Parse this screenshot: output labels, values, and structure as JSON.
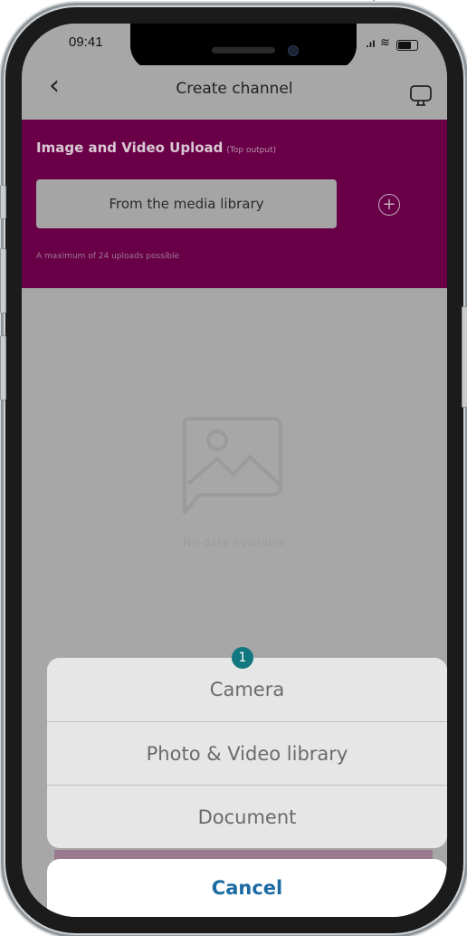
{
  "status_bar": {
    "time": "09:41"
  },
  "nav": {
    "back_icon": "chevron-left-icon",
    "title": "Create channel",
    "device_icon": "monitor-icon"
  },
  "upload": {
    "title": "Image and Video Upload",
    "subtitle": "(Top output)",
    "library_button": "From the media library",
    "add_icon": "plus-circle-icon",
    "max_note": "A maximum of  24 uploads possible"
  },
  "empty": {
    "icon": "image-placeholder-icon",
    "text": "No data available"
  },
  "badge": "1",
  "action_sheet": {
    "items": [
      "Camera",
      "Photo & Video library",
      "Document"
    ],
    "cancel": "Cancel"
  },
  "colors": {
    "header": "#690047",
    "overlay": "#a7a7a7",
    "cancel_text": "#1c6ca3",
    "badge": "#13777f"
  }
}
